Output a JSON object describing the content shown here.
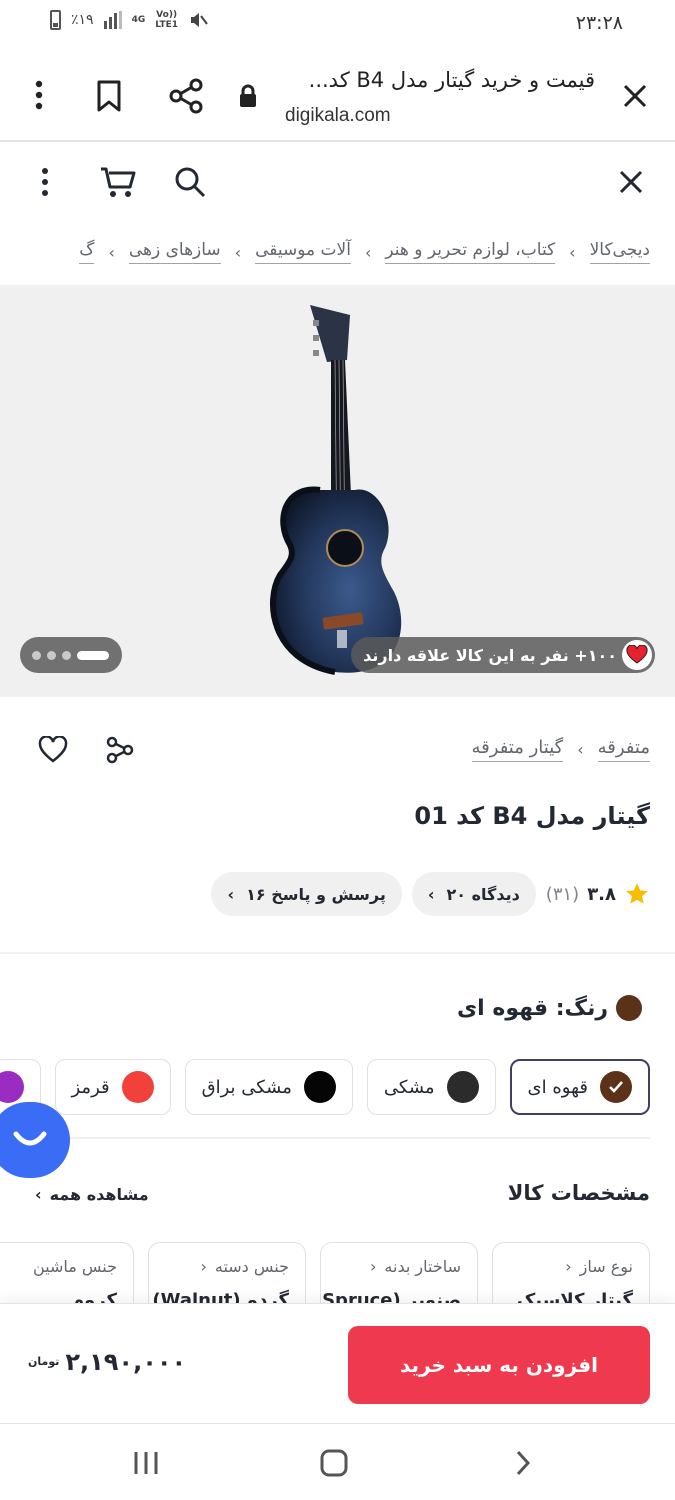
{
  "status_bar": {
    "time": "۲۳:۲۸",
    "battery": "٪۱۹",
    "network": "4G",
    "volte": "Vo))",
    "lte": "LTE1"
  },
  "browser": {
    "page_title": "قیمت و خرید گیتار مدل B4 کد...",
    "domain": "digikala.com"
  },
  "breadcrumbs": [
    "دیجی‌کالا",
    "کتاب، لوازم تحریر و هنر",
    "آلات موسیقی",
    "سازهای زهی",
    "گ"
  ],
  "gallery": {
    "likes_text": "۱۰۰+ نفر به این کالا علاقه دارند"
  },
  "product": {
    "category_crumbs": [
      "متفرقه",
      "گیتار متفرقه"
    ],
    "title": "گیتار مدل B4 کد 01",
    "rating": "۳.۸",
    "rating_count": "(۳۱)",
    "chips": [
      "۲۰ دیدگاه",
      "۱۶ پرسش و پاسخ"
    ],
    "color_label": "رنگ: قهوه ای",
    "swatches": [
      {
        "label": "قهوه ای",
        "color": "#5b3218",
        "selected": true
      },
      {
        "label": "مشکی",
        "color": "#2b2b2b",
        "selected": false
      },
      {
        "label": "مشکی براق",
        "color": "#050505",
        "selected": false
      },
      {
        "label": "قرمز",
        "color": "#f2403a",
        "selected": false
      },
      {
        "label": "",
        "color": "#9b2cc1",
        "selected": false
      }
    ],
    "specs_title": "مشخصات کالا",
    "see_all": "مشاهده همه",
    "specs": [
      {
        "key": "نوع ساز",
        "value": "گیتار کلاسیک"
      },
      {
        "key": "ساختار بدنه",
        "value": "صنوبر (Spruce)"
      },
      {
        "key": "جنس دسته",
        "value": "گردو (Walnut)"
      },
      {
        "key": "جنس ماشین",
        "value": "کروم"
      }
    ]
  },
  "buy_bar": {
    "button_label": "افزودن به سبد خرید",
    "price": "۲,۱۹۰,۰۰۰",
    "currency": "تومان"
  },
  "colors": {
    "accent": "#ef394e",
    "chat": "#3b6cf6",
    "selected_border": "#3f4064"
  }
}
